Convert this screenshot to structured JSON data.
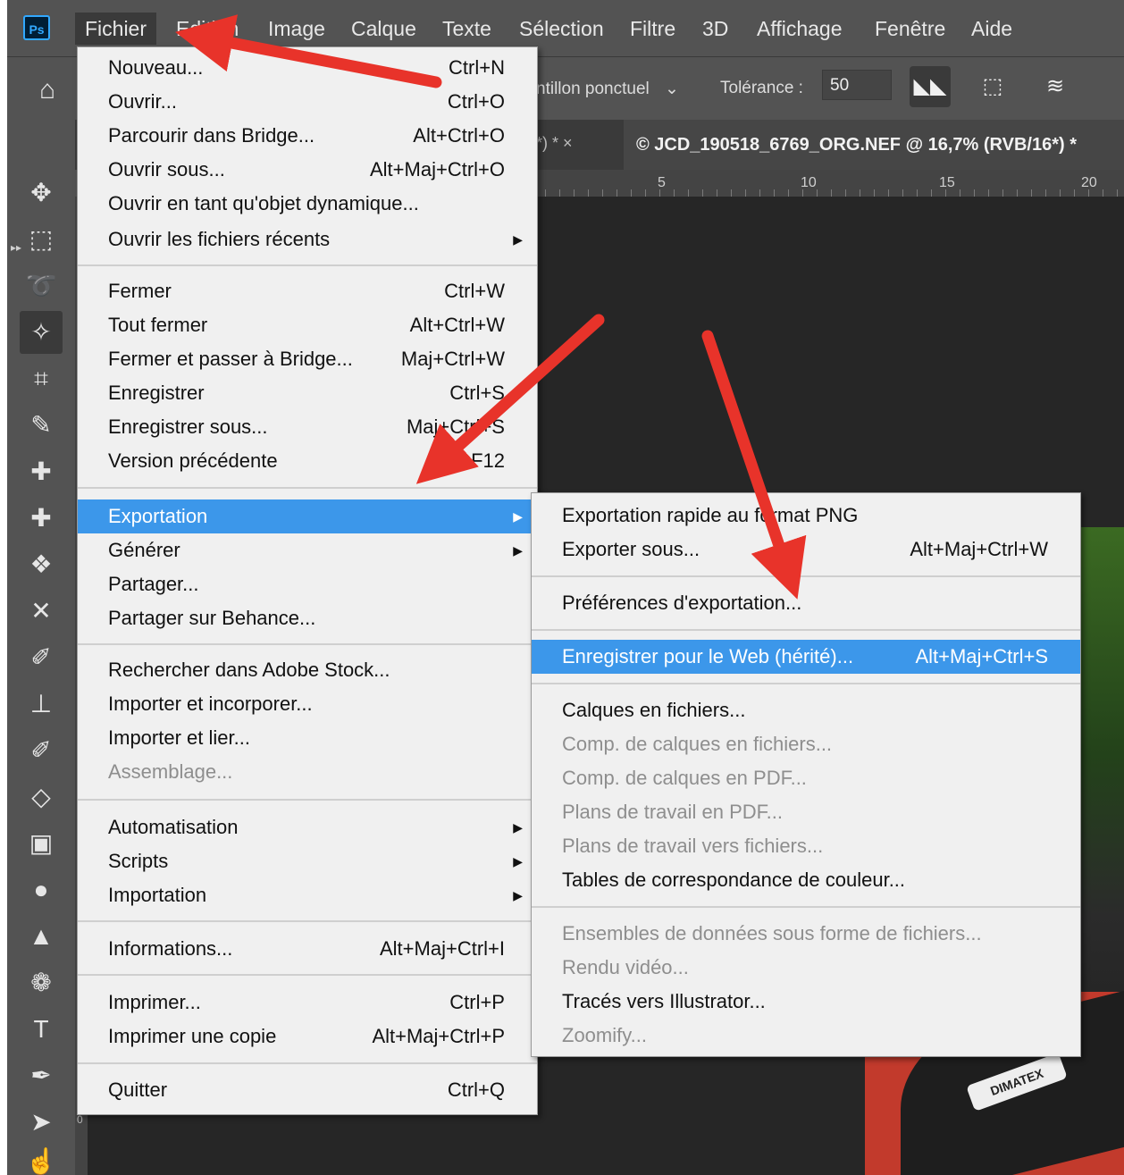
{
  "app": {
    "logo": "Ps"
  },
  "menubar": [
    {
      "label": "Fichier",
      "active": true
    },
    {
      "label": "Edition"
    },
    {
      "label": "Image"
    },
    {
      "label": "Calque"
    },
    {
      "label": "Texte"
    },
    {
      "label": "Sélection"
    },
    {
      "label": "Filtre"
    },
    {
      "label": "3D"
    },
    {
      "label": "Affichage"
    },
    {
      "label": "Fenêtre"
    },
    {
      "label": "Aide"
    }
  ],
  "options": {
    "sample_value": "ntillon ponctuel",
    "tolerance_label": "Tolérance :",
    "tolerance_value": "50"
  },
  "tabs": {
    "previous_tail": "*) * ×",
    "active": "© JCD_190518_6769_ORG.NEF @ 16,7% (RVB/16*) *"
  },
  "ruler": {
    "marks": [
      "5",
      "10",
      "15",
      "20"
    ],
    "vertical_zero": "0"
  },
  "canvas": {
    "photo_label": "DIMATEX"
  },
  "file_menu": [
    {
      "label": "Nouveau...",
      "shortcut": "Ctrl+N"
    },
    {
      "label": "Ouvrir...",
      "shortcut": "Ctrl+O"
    },
    {
      "label": "Parcourir dans Bridge...",
      "shortcut": "Alt+Ctrl+O"
    },
    {
      "label": "Ouvrir sous...",
      "shortcut": "Alt+Maj+Ctrl+O"
    },
    {
      "label": "Ouvrir en tant qu'objet dynamique...",
      "shortcut": ""
    },
    {
      "label": "Ouvrir les fichiers récents",
      "shortcut": "",
      "submenu": true
    },
    {
      "label": "Fermer",
      "shortcut": "Ctrl+W"
    },
    {
      "label": "Tout fermer",
      "shortcut": "Alt+Ctrl+W"
    },
    {
      "label": "Fermer et passer à Bridge...",
      "shortcut": "Maj+Ctrl+W"
    },
    {
      "label": "Enregistrer",
      "shortcut": "Ctrl+S"
    },
    {
      "label": "Enregistrer sous...",
      "shortcut": "Maj+Ctrl+S"
    },
    {
      "label": "Version précédente",
      "shortcut": "F12"
    },
    {
      "label": "Exportation",
      "shortcut": "",
      "submenu": true,
      "highlighted": true
    },
    {
      "label": "Générer",
      "shortcut": "",
      "submenu": true
    },
    {
      "label": "Partager...",
      "shortcut": ""
    },
    {
      "label": "Partager sur Behance...",
      "shortcut": ""
    },
    {
      "label": "Rechercher dans Adobe Stock...",
      "shortcut": ""
    },
    {
      "label": "Importer et incorporer...",
      "shortcut": ""
    },
    {
      "label": "Importer et lier...",
      "shortcut": ""
    },
    {
      "label": "Assemblage...",
      "shortcut": "",
      "disabled": true
    },
    {
      "label": "Automatisation",
      "shortcut": "",
      "submenu": true
    },
    {
      "label": "Scripts",
      "shortcut": "",
      "submenu": true
    },
    {
      "label": "Importation",
      "shortcut": "",
      "submenu": true
    },
    {
      "label": "Informations...",
      "shortcut": "Alt+Maj+Ctrl+I"
    },
    {
      "label": "Imprimer...",
      "shortcut": "Ctrl+P"
    },
    {
      "label": "Imprimer une copie",
      "shortcut": "Alt+Maj+Ctrl+P"
    },
    {
      "label": "Quitter",
      "shortcut": "Ctrl+Q"
    }
  ],
  "export_submenu": [
    {
      "label": "Exportation rapide au format PNG",
      "shortcut": ""
    },
    {
      "label": "Exporter sous...",
      "shortcut": "Alt+Maj+Ctrl+W"
    },
    {
      "label": "Préférences d'exportation...",
      "shortcut": ""
    },
    {
      "label": "Enregistrer pour le Web (hérité)...",
      "shortcut": "Alt+Maj+Ctrl+S",
      "highlighted": true
    },
    {
      "label": "Calques en fichiers...",
      "shortcut": ""
    },
    {
      "label": "Comp. de calques en fichiers...",
      "shortcut": "",
      "disabled": true
    },
    {
      "label": "Comp. de calques en PDF...",
      "shortcut": "",
      "disabled": true
    },
    {
      "label": "Plans de travail en PDF...",
      "shortcut": "",
      "disabled": true
    },
    {
      "label": "Plans de travail vers fichiers...",
      "shortcut": "",
      "disabled": true
    },
    {
      "label": "Tables de correspondance de couleur...",
      "shortcut": ""
    },
    {
      "label": "Ensembles de données sous forme de fichiers...",
      "shortcut": "",
      "disabled": true
    },
    {
      "label": "Rendu vidéo...",
      "shortcut": "",
      "disabled": true
    },
    {
      "label": "Tracés vers Illustrator...",
      "shortcut": ""
    },
    {
      "label": "Zoomify...",
      "shortcut": "",
      "disabled": true
    }
  ],
  "tools": [
    "move-tool-icon",
    "marquee-tool-icon",
    "lasso-tool-icon",
    "magic-wand-tool-icon",
    "crop-tool-icon",
    "eyedropper-tool-icon",
    "spot-healing-tool-icon",
    "healing-brush-tool-icon",
    "patch-tool-icon",
    "content-aware-move-tool-icon",
    "brush-tool-icon",
    "clone-stamp-tool-icon",
    "history-brush-tool-icon",
    "eraser-tool-icon",
    "gradient-tool-icon",
    "blur-tool-icon",
    "sharpen-tool-icon",
    "sponge-tool-icon",
    "type-tool-icon",
    "pen-tool-icon",
    "path-selection-tool-icon",
    "hand-tool-icon"
  ],
  "colors": {
    "highlight": "#3c97ea",
    "arrow": "#e8332a",
    "menu_bg": "#f0f0f0",
    "ui_bg": "#535353"
  }
}
